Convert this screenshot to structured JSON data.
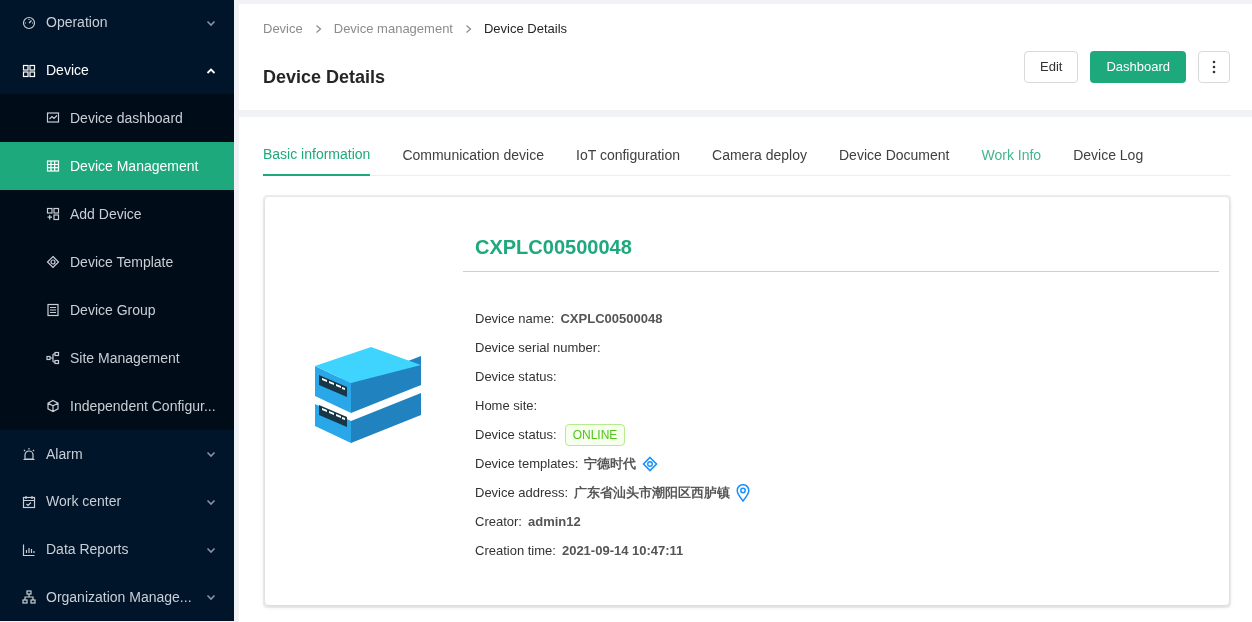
{
  "sidebar": {
    "items": [
      {
        "label": "Operation",
        "expanded": false
      },
      {
        "label": "Device",
        "expanded": true,
        "children": [
          {
            "label": "Device dashboard",
            "selected": false
          },
          {
            "label": "Device Management",
            "selected": true
          },
          {
            "label": "Add Device",
            "selected": false
          },
          {
            "label": "Device Template",
            "selected": false
          },
          {
            "label": "Device Group",
            "selected": false
          },
          {
            "label": "Site Management",
            "selected": false
          },
          {
            "label": "Independent Configur...",
            "selected": false
          }
        ]
      },
      {
        "label": "Alarm",
        "expanded": false
      },
      {
        "label": "Work center",
        "expanded": false
      },
      {
        "label": "Data Reports",
        "expanded": false
      },
      {
        "label": "Organization Manage...",
        "expanded": false
      }
    ]
  },
  "breadcrumb": [
    "Device",
    "Device management",
    "Device Details"
  ],
  "page_title": "Device Details",
  "actions": {
    "edit": "Edit",
    "dashboard": "Dashboard"
  },
  "tabs": [
    {
      "label": "Basic information",
      "selected": true,
      "hovered": false
    },
    {
      "label": "Communication device",
      "selected": false,
      "hovered": false
    },
    {
      "label": "IoT configuration",
      "selected": false,
      "hovered": false
    },
    {
      "label": "Camera deploy",
      "selected": false,
      "hovered": false
    },
    {
      "label": "Device Document",
      "selected": false,
      "hovered": false
    },
    {
      "label": "Work Info",
      "selected": false,
      "hovered": true
    },
    {
      "label": "Device Log",
      "selected": false,
      "hovered": false
    }
  ],
  "device": {
    "heading": "CXPLC00500048",
    "fields": [
      {
        "kind": "text",
        "label": "Device name:",
        "value": "CXPLC00500048"
      },
      {
        "kind": "text",
        "label": "Device serial number:"
      },
      {
        "kind": "text",
        "label": "Device status:"
      },
      {
        "kind": "text",
        "label": "Home site:"
      },
      {
        "kind": "tag",
        "label": "Device status:",
        "value": "ONLINE"
      },
      {
        "kind": "template",
        "label": "Device templates:",
        "value": "宁德时代"
      },
      {
        "kind": "location",
        "label": "Device address:",
        "value": "广东省汕头市潮阳区西胪镇"
      },
      {
        "kind": "text",
        "label": "Creator:",
        "value": "admin12"
      },
      {
        "kind": "text",
        "label": "Creation time:",
        "value": "2021-09-14 10:47:11"
      }
    ]
  }
}
